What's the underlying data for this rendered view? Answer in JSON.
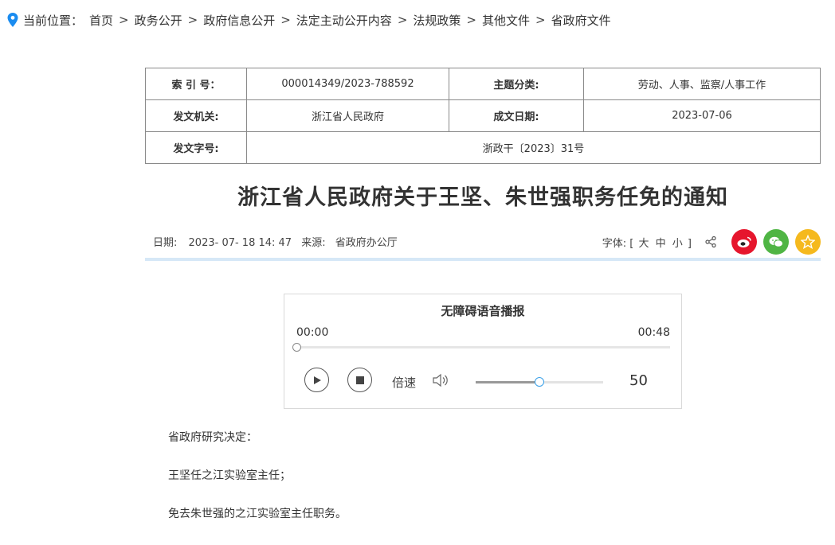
{
  "breadcrumb": {
    "prefix": "当前位置：",
    "items": [
      "首页",
      "政务公开",
      "政府信息公开",
      "法定主动公开内容",
      "法规政策",
      "其他文件",
      "省政府文件"
    ],
    "separator": ">"
  },
  "meta": {
    "index_label": "索 引 号：",
    "index_value": "000014349/2023-788592",
    "topic_label": "主题分类:",
    "topic_value": "劳动、人事、监察/人事工作",
    "issuer_label": "发文机关:",
    "issuer_value": "浙江省人民政府",
    "date_label": "成文日期:",
    "date_value": "2023-07-06",
    "docno_label": "发文字号:",
    "docno_value": "浙政干〔2023〕31号"
  },
  "article": {
    "title": "浙江省人民政府关于王坚、朱世强职务任免的通知",
    "date_label": "日期:",
    "date_value": "2023- 07- 18 14: 47",
    "source_label": "来源:",
    "source_value": "省政府办公厅",
    "font_label": "字体:",
    "font_open": "[",
    "font_large": "大",
    "font_medium": "中",
    "font_small": "小",
    "font_close": "]",
    "paragraphs": [
      "省政府研究决定：",
      "王坚任之江实验室主任；",
      "免去朱世强的之江实验室主任职务。"
    ]
  },
  "player": {
    "title": "无障碍语音播报",
    "current_time": "00:00",
    "total_time": "00:48",
    "progress": 0.0,
    "speed_label": "倍速",
    "volume": 50
  },
  "icons": {
    "location": "map-pin-icon",
    "share": "share-icon",
    "weibo": "weibo-icon",
    "wechat": "wechat-icon",
    "favorite": "star-icon"
  },
  "colors": {
    "pin": "#1a8cf0",
    "weibo": "#e6162d",
    "wechat": "#4fb544",
    "favorite": "#f5b91e",
    "divider": "#d6e8f7",
    "volume_knob": "#3aa0e8"
  }
}
